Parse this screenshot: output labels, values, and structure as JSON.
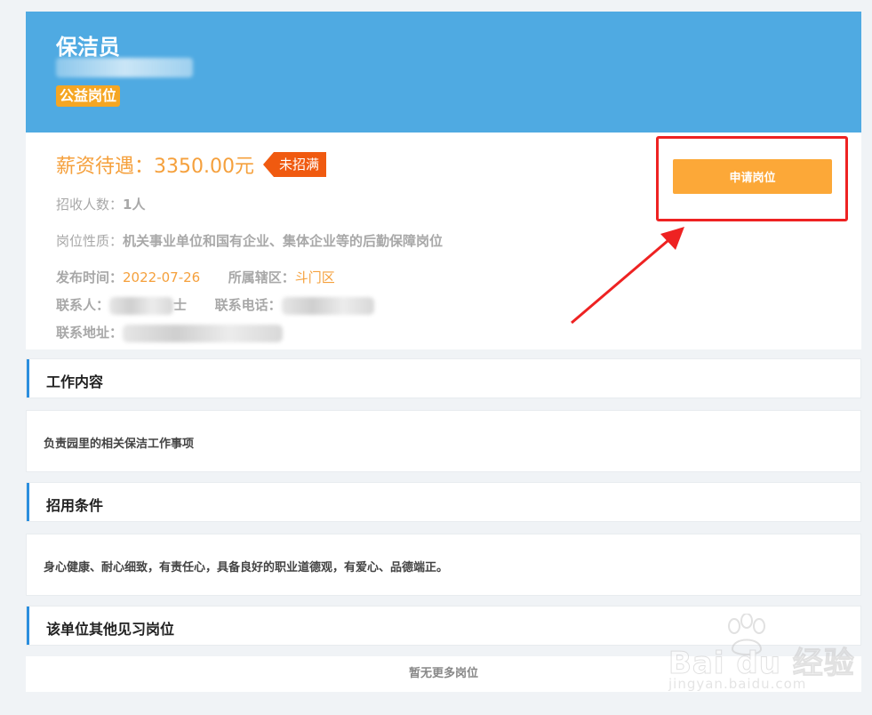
{
  "header": {
    "job_title": "保洁员",
    "tag": "公益岗位"
  },
  "info": {
    "salary_label": "薪资待遇：",
    "salary_value": "3350.00元",
    "status": "未招满",
    "headcount_label": "招收人数：",
    "headcount_value": "1人",
    "nature_label": "岗位性质：",
    "nature_value": "机关事业单位和国有企业、集体企业等的后勤保障岗位",
    "publish_label": "发布时间：",
    "publish_value": "2022-07-26",
    "district_label": "所属辖区：",
    "district_value": "斗门区",
    "contact_label": "联系人：",
    "contact_suffix": "士",
    "phone_label": "联系电话：",
    "address_label": "联系地址："
  },
  "apply": {
    "label": "申请岗位"
  },
  "sections": {
    "work_title": "工作内容",
    "work_body": "负责园里的相关保洁工作事项",
    "req_title": "招用条件",
    "req_body": "身心健康、耐心细致，有责任心，具备良好的职业道德观，有爱心、品德端正。",
    "other_title": "该单位其他见习岗位",
    "no_more": "暂无更多岗位"
  },
  "watermark": {
    "main": "Bai du 经验",
    "sub": "jingyan.baidu.com"
  },
  "colors": {
    "header_bg": "#4faae2",
    "accent_orange": "#f5a03c",
    "status_red": "#f05a10",
    "highlight_red": "#ee2222",
    "section_bar": "#2b8ede"
  }
}
